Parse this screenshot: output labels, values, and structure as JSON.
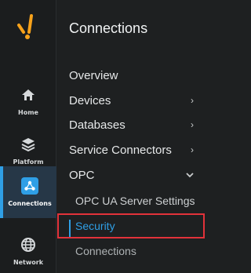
{
  "rail": {
    "items": [
      {
        "label": "Home",
        "icon": "home-icon"
      },
      {
        "label": "Platform",
        "icon": "layers-icon"
      },
      {
        "label": "Connections",
        "icon": "connections-icon"
      },
      {
        "label": "Network",
        "icon": "globe-icon"
      }
    ],
    "active_index": 2
  },
  "panel": {
    "title": "Connections",
    "items": [
      {
        "label": "Overview"
      },
      {
        "label": "Devices",
        "chevron": "chevron-right-icon"
      },
      {
        "label": "Databases",
        "chevron": "chevron-right-icon"
      },
      {
        "label": "Service Connectors",
        "chevron": "chevron-right-icon"
      },
      {
        "label": "OPC",
        "chevron": "chevron-down-icon"
      }
    ],
    "opc_children": [
      {
        "label": "OPC UA Server Settings"
      },
      {
        "label": "Security"
      },
      {
        "label": "Connections"
      }
    ],
    "selected": "Security"
  },
  "colors": {
    "accent": "#2f9fe6",
    "logo_orange": "#f7a21b",
    "highlight_red": "#e2323a",
    "background": "#1e2021"
  }
}
